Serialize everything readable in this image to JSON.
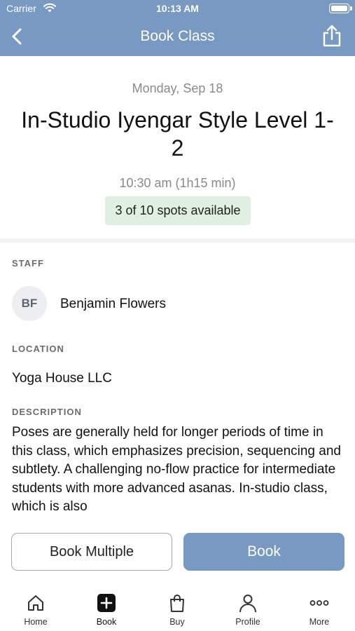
{
  "status_bar": {
    "carrier": "Carrier",
    "time": "10:13 AM"
  },
  "nav": {
    "title": "Book Class",
    "back_icon": "chevron-left-icon",
    "share_icon": "share-icon"
  },
  "class": {
    "date": "Monday, Sep 18",
    "title": "In-Studio Iyengar Style Level 1-2",
    "time": "10:30 am (1h15 min)",
    "spots": "3 of 10 spots available"
  },
  "staff": {
    "label": "STAFF",
    "initials": "BF",
    "name": "Benjamin Flowers"
  },
  "location": {
    "label": "LOCATION",
    "name": "Yoga House LLC"
  },
  "description": {
    "label": "DESCRIPTION",
    "text": "Poses are generally held for longer periods of time in this class, which emphasizes precision, sequencing and subtlety. A challenging no-flow practice for intermediate students with more advanced asanas. In-studio class, which is also"
  },
  "actions": {
    "book_multiple": "Book Multiple",
    "book": "Book"
  },
  "tabs": [
    {
      "label": "Home",
      "icon": "home-icon"
    },
    {
      "label": "Book",
      "icon": "plus-square-icon"
    },
    {
      "label": "Buy",
      "icon": "shopping-bag-icon"
    },
    {
      "label": "Profile",
      "icon": "person-icon"
    },
    {
      "label": "More",
      "icon": "more-dots-icon"
    }
  ],
  "colors": {
    "accent": "#7899c1",
    "spots_bg": "#dff0e0"
  }
}
